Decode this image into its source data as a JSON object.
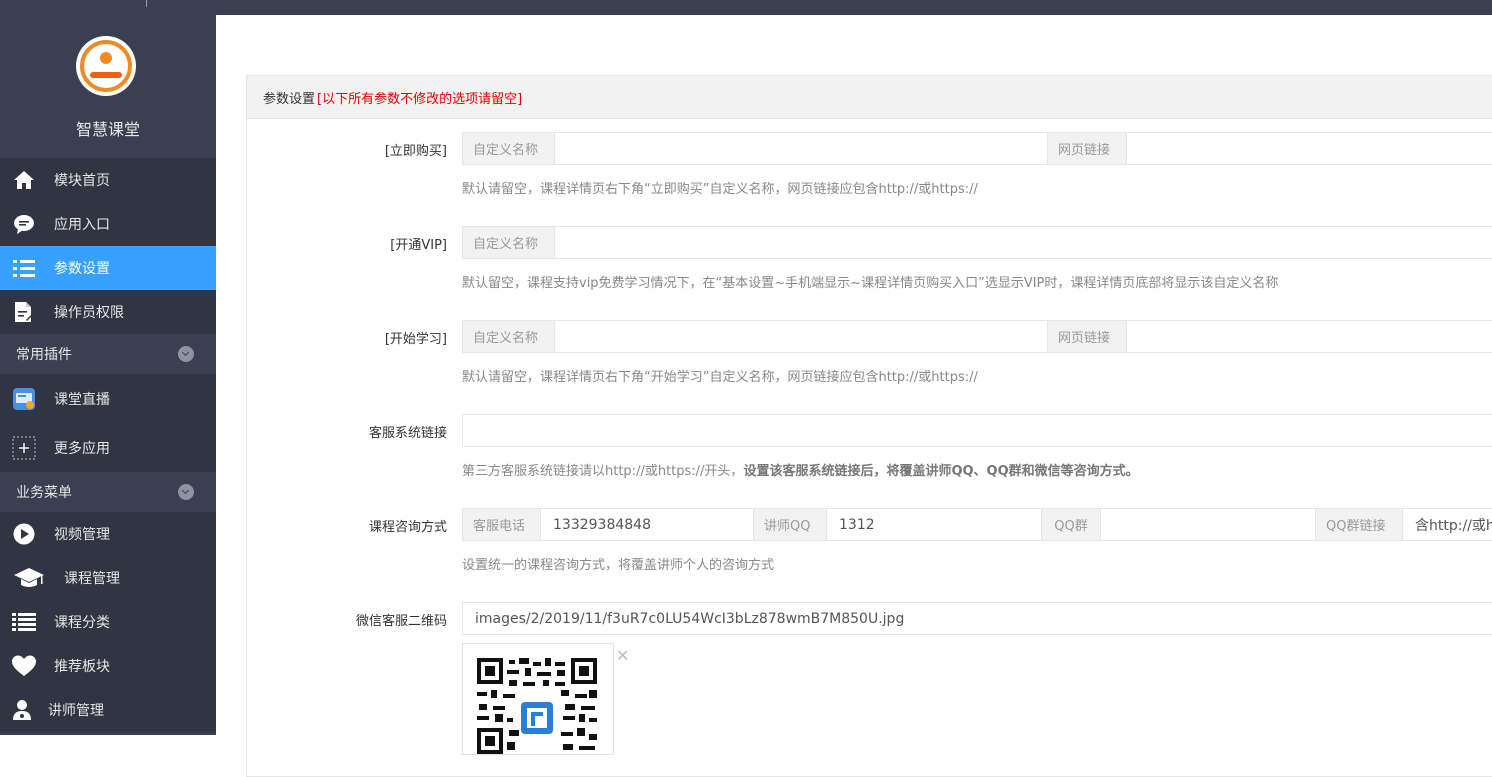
{
  "sidebar": {
    "brand": "智慧课堂",
    "items": [
      {
        "label": "模块首页",
        "icon": "home-icon"
      },
      {
        "label": "应用入口",
        "icon": "chat-icon"
      },
      {
        "label": "参数设置",
        "icon": "list-icon"
      },
      {
        "label": "操作员权限",
        "icon": "document-edit-icon"
      }
    ],
    "groups": [
      {
        "label": "常用插件",
        "items": [
          {
            "label": "课堂直播"
          },
          {
            "label": "更多应用"
          }
        ]
      },
      {
        "label": "业务菜单",
        "items": [
          {
            "label": "视频管理"
          },
          {
            "label": "课程管理"
          },
          {
            "label": "课程分类"
          },
          {
            "label": "推荐板块"
          },
          {
            "label": "讲师管理"
          }
        ]
      }
    ]
  },
  "panel": {
    "title": "参数设置",
    "note": "[以下所有参数不修改的选项请留空]"
  },
  "form": {
    "buy_now": {
      "label": "[立即购买]",
      "name_addon": "自定义名称",
      "link_addon": "网页链接",
      "hint": "默认请留空，课程详情页右下角“立即购买”自定义名称，网页链接应包含http://或https://"
    },
    "open_vip": {
      "label": "[开通VIP]",
      "name_addon": "自定义名称",
      "hint": "默认留空，课程支持vip免费学习情况下，在“基本设置~手机端显示~课程详情页购买入口”选显示VIP时，课程详情页底部将显示该自定义名称"
    },
    "start_learn": {
      "label": "[开始学习]",
      "name_addon": "自定义名称",
      "link_addon": "网页链接",
      "hint": "默认请留空，课程详情页右下角“开始学习”自定义名称，网页链接应包含http://或https://"
    },
    "service_link": {
      "label": "客服系统链接",
      "hint_plain": "第三方客服系统链接请以http://或https://开头，",
      "hint_bold": "设置该客服系统链接后，将覆盖讲师QQ、QQ群和微信等咨询方式。"
    },
    "consult": {
      "label": "课程咨询方式",
      "phone_addon": "客服电话",
      "phone_value": "13329384848",
      "qq_addon": "讲师QQ",
      "qq_value": "1312",
      "group_addon": "QQ群",
      "group_link_addon": "QQ群链接",
      "group_link_placeholder": "含http://或h",
      "hint": "设置统一的课程咨询方式，将覆盖讲师个人的咨询方式"
    },
    "wechat_qr": {
      "label": "微信客服二维码",
      "value": "images/2/2019/11/f3uR7c0LU54WcI3bLz878wmB7M850U.jpg"
    }
  },
  "colors": {
    "sidebar_bg": "#3a3f51",
    "active": "#38a0ff",
    "note": "#e60000"
  }
}
